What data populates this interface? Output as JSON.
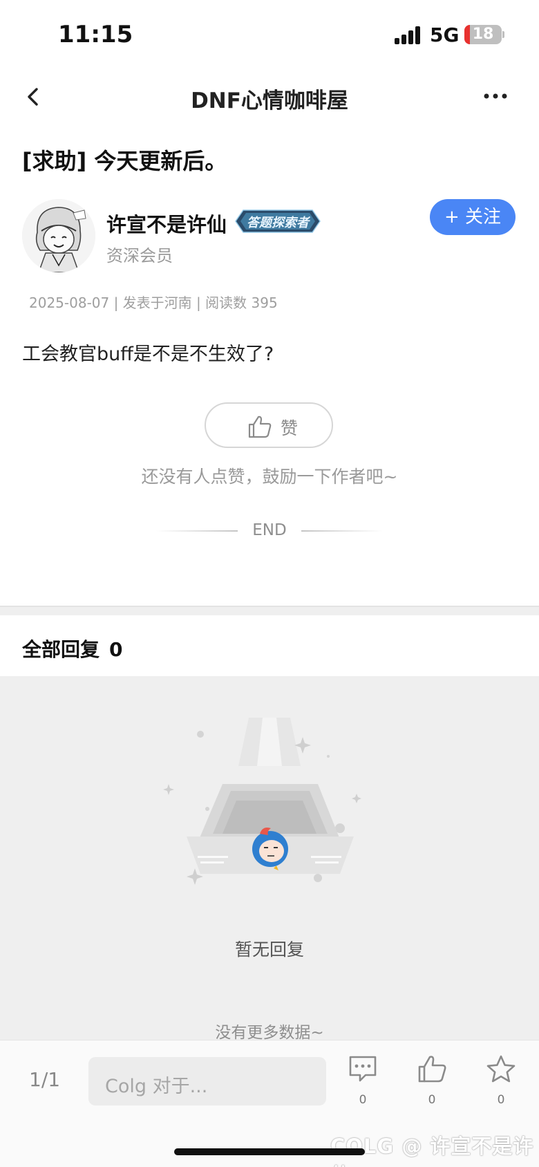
{
  "status_bar": {
    "time": "11:15",
    "network": "5G",
    "battery": "18"
  },
  "nav": {
    "title": "DNF心情咖啡屋"
  },
  "post": {
    "title": "[求助] 今天更新后。",
    "author": {
      "name": "许宣不是许仙",
      "badge": "答题探索者",
      "level": "资深会员"
    },
    "follow_label": "+ 关注",
    "meta": "2025-08-07 | 发表于河南 | 阅读数 395",
    "content": "工会教官buff是不是不生效了?",
    "like_label": "赞",
    "like_hint": "还没有人点赞，鼓励一下作者吧~",
    "end_label": "END"
  },
  "replies": {
    "header": "全部回复",
    "count": "0",
    "empty_text": "暂无回复",
    "no_more": "没有更多数据~"
  },
  "bottom_bar": {
    "page_indicator": "1/1",
    "input_placeholder": "Colg 对于...",
    "comment_count": "0",
    "like_count": "0",
    "favorite_count": "0",
    "watermark": "COLG @ 许宣不是许仙"
  },
  "colors": {
    "accent": "#4a86f5",
    "page_bg": "#ffffff",
    "section_bg": "#efefef"
  }
}
